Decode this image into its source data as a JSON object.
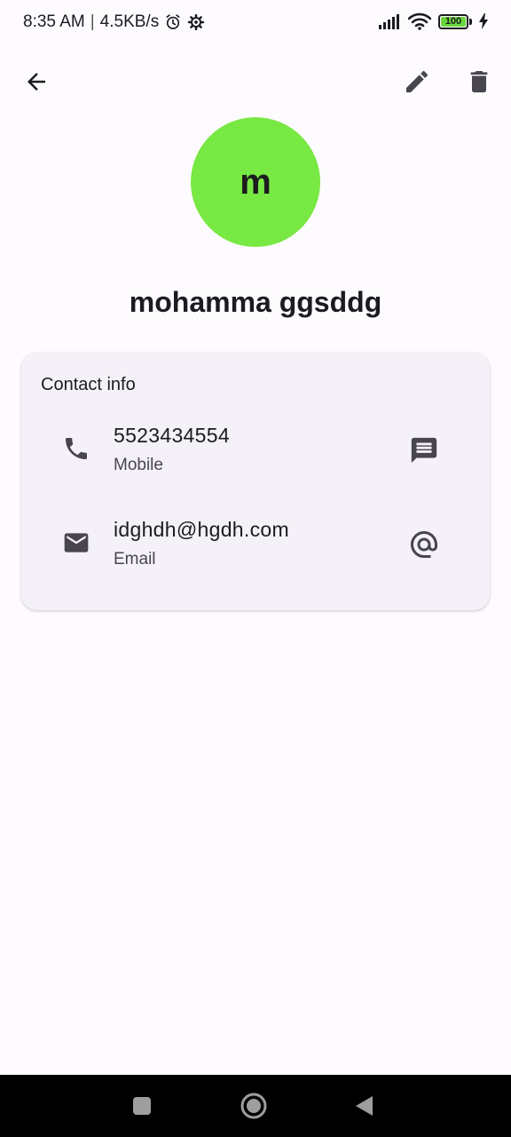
{
  "status_bar": {
    "time": "8:35 AM",
    "separator": "|",
    "network_speed": "4.5KB/s",
    "left_icons": [
      "alarm-icon",
      "settings-icon"
    ],
    "right_icons": [
      "signal-icon",
      "wifi-icon",
      "battery-icon",
      "charging-icon"
    ],
    "battery_level": "100",
    "battery_color": "#6ad63c"
  },
  "app_bar": {
    "back_icon": "arrow-back-icon",
    "edit_icon": "pencil-icon",
    "delete_icon": "trash-icon"
  },
  "contact": {
    "avatar_letter": "m",
    "avatar_color": "#78e843",
    "name": "mohamma ggsddg"
  },
  "contact_info": {
    "title": "Contact info",
    "phone": {
      "value": "5523434554",
      "type": "Mobile",
      "icon": "phone-icon",
      "action_icon": "message-icon"
    },
    "email": {
      "value": "idghdh@hgdh.com",
      "type": "Email",
      "icon": "mail-icon",
      "action_icon": "at-sign-icon"
    }
  },
  "nav_bar": {
    "buttons": [
      "recents-button",
      "home-button",
      "back-button"
    ]
  }
}
